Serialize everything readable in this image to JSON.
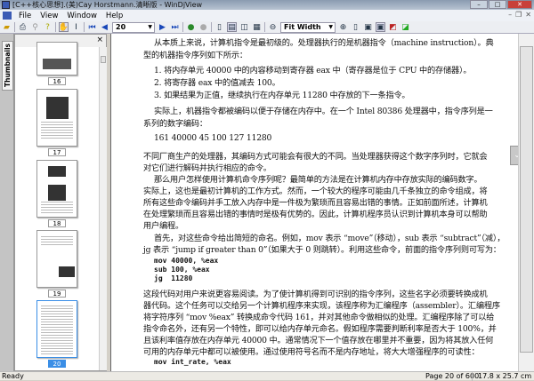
{
  "window": {
    "title": "[C++核心思想].(美)Cay Horstmann.清晰版 - WinDjView",
    "minimize": "–",
    "maximize": "□",
    "close": "✕"
  },
  "menu": [
    "File",
    "View",
    "Window",
    "Help"
  ],
  "toolbar": {
    "page_value": "20",
    "zoom_value": "Fit Width"
  },
  "sidebar": {
    "tab_label": "Thumbnails",
    "close": "×",
    "thumbnails": [
      "16",
      "17",
      "18",
      "19",
      "20"
    ],
    "current": "20"
  },
  "document": {
    "lines": [
      "从本质上来说，计算机指令是最初级的。处理器执行的是机器指令（machine instruction）。典",
      "型的机器指令序列如下所示：",
      "1. 将内存单元 40000 中的内容移动到寄存器 eax 中（寄存器是位于 CPU 中的存储器）。",
      "2. 将寄存器 eax 中的值减去 100。",
      "3. 如果结果为正值，继续执行在内存单元 11280 中存放的下一条指令。",
      "实际上，机器指令都被编码以便于存储在内存中。在一个 Intel 80386 处理器中，指令序列是一",
      "系列的数字编码：",
      "161 40000 45 100 127 11280",
      "不同厂商生产的处理器，其编码方式可能会有很大的不同。当处理器获得这个数字序列时，它就会",
      "对它们进行解码并执行相应的命令。",
      "那么用户怎样使用计算机命令序列呢？最简单的方法是在计算机内存中存放实际的编码数字。",
      "实际上，这也是最初计算机的工作方式。然而，一个较大的程序可能由几千条独立的命令组成，将",
      "所有这些命令编码并手工放入内存中是一件极为繁琐而且容易出错的事情。正如前面所述，计算机",
      "在处理繁琐而且容易出错的事情时是极有优势的。因此，计算机程序员认识到计算机本身可以帮助",
      "用户编程。",
      "首先，对这些命令给出简短的命名。例如，mov 表示 “move”（移动），sub 表示 “subtract”（减），",
      "jg 表示 “jump if greater than 0”（如果大于 0 则跳转）。利用这些命令，前面的指令序列则可写为：",
      "这段代码对用户来说更容易阅读。为了使计算机得到可识别的指令序列，这些名字必须要转换成机",
      "器代码。这个任务可以交给另一个计算机程序来实现，该程序称为汇编程序（assembler）。汇编程序",
      "将字符序列 “mov %eax” 转换成命令代码 161，并对其他命令做相似的处理。汇编程序除了可以给",
      "指令命名外，还有另一个特性，即可以给内存单元命名。假如程序需要判断利率是否大于 100%，并",
      "且该利率值存放在内存单元 40000 中。通常情况下一个值存放在哪里并不重要，因为将其放入任何",
      "可用的内存单元中都可以被使用。通过使用符号名而不是内存地址，将大大增强程序的可读性："
    ],
    "code1": [
      "mov 40000, %eax",
      "sub 100, %eax",
      "jg  11280"
    ],
    "code2": "mov int_rate, %eax"
  },
  "status": {
    "ready": "Ready",
    "page": "Page 20 of 600",
    "size": "17.8 x 25.7 cm"
  }
}
